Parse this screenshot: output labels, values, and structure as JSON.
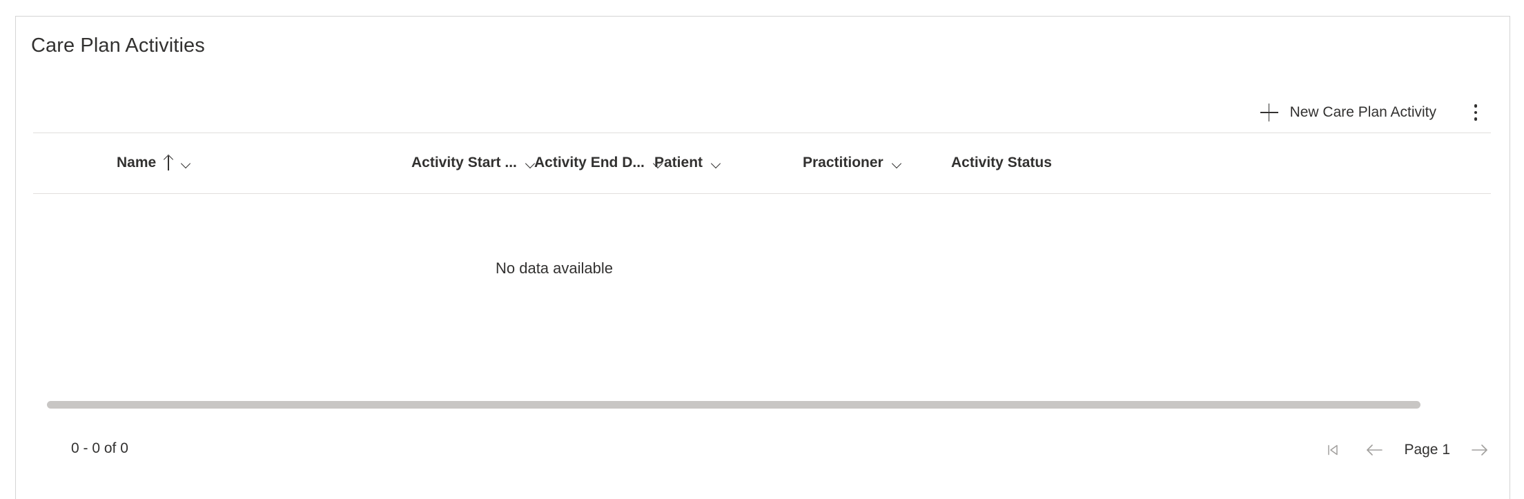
{
  "card": {
    "title": "Care Plan Activities"
  },
  "toolbar": {
    "new_label": "New Care Plan Activity",
    "new_icon": "plus-icon",
    "overflow_icon": "more-vertical-icon"
  },
  "grid": {
    "columns": [
      {
        "label": "Name",
        "sorted": "ascending",
        "has_menu": true
      },
      {
        "label": "Activity Start ...",
        "sorted": "none",
        "has_menu": true
      },
      {
        "label": "Activity End D...",
        "sorted": "none",
        "has_menu": true
      },
      {
        "label": "Patient",
        "sorted": "none",
        "has_menu": true
      },
      {
        "label": "Practitioner",
        "sorted": "none",
        "has_menu": true
      },
      {
        "label": "Activity Status",
        "sorted": "none",
        "has_menu": false
      }
    ],
    "rows": [],
    "empty_message": "No data available"
  },
  "footer": {
    "record_count": "0 - 0 of 0",
    "page_label": "Page 1",
    "first_page_icon": "first-page-icon",
    "previous_page_icon": "arrow-left-icon",
    "next_page_icon": "arrow-right-icon"
  },
  "colors": {
    "border": "#d4d4d4",
    "divider": "#e1dfdd",
    "text": "#323130",
    "disabled": "#a19f9d",
    "scrollbar": "#c8c6c4"
  }
}
